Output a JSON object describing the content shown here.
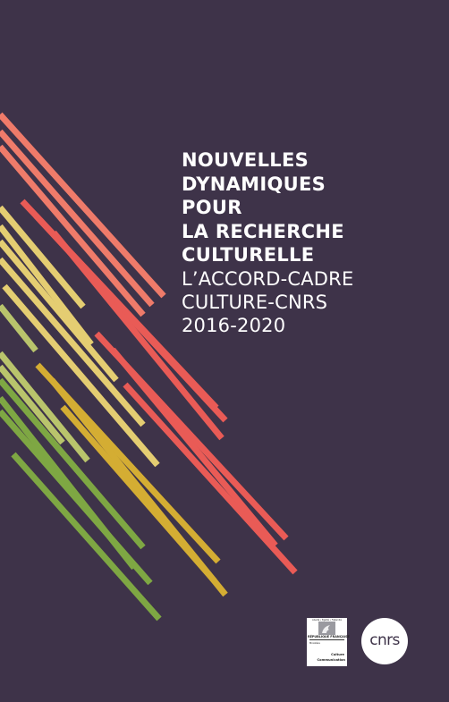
{
  "cover": {
    "title_lines": [
      "NOUVELLES",
      "DYNAMIQUES",
      "POUR",
      "LA RECHERCHE",
      "CULTURELLE"
    ],
    "subtitle_lines": [
      "L’ACCORD-CADRE",
      "CULTURE-CNRS",
      "2016-2020"
    ]
  },
  "logos": {
    "ministry": {
      "motto": "Liberté • Égalité • Fraternité",
      "republic": "RÉPUBLIQUE FRANÇAISE",
      "ministry_label": "Ministère",
      "culture_line1": "Culture",
      "culture_line2": "Communication"
    },
    "cnrs": {
      "text": "cnrs"
    }
  },
  "colors": {
    "background": "#3e3349",
    "stripes": [
      "#ef7b6a",
      "#e95b56",
      "#e4cd72",
      "#d4ad33",
      "#b9c46c",
      "#7ea743"
    ]
  },
  "icons": [
    "marianne-emblem-icon",
    "cnrs-logo-icon"
  ]
}
